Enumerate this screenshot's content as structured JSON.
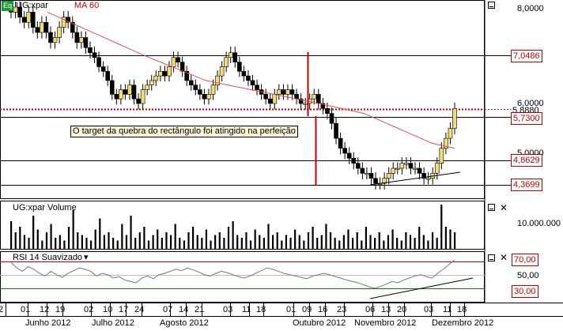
{
  "main": {
    "symbol_badge": "Eq",
    "symbol": "UG:xpar",
    "indicator": "MA 60",
    "annotation": "O target da quebra do rectângulo foi atingido na perfeição",
    "axis_labels": [
      "8,0000",
      "6,0000",
      "5,0000"
    ],
    "price_tags": [
      {
        "text": "7,0486",
        "color": "#c00000",
        "value": 7.0486
      },
      {
        "text": "5,8880",
        "color": "#000000",
        "value": 5.888
      },
      {
        "text": "5,7300",
        "color": "#c00000",
        "value": 5.73
      },
      {
        "text": "4,8629",
        "color": "#c00000",
        "value": 4.8629
      },
      {
        "text": "4,3699",
        "color": "#c00000",
        "value": 4.3699
      }
    ]
  },
  "volume": {
    "title": "UG:xpar Volume",
    "axis_label": "10.000.000"
  },
  "rsi": {
    "title": "RSI 14 Suavizado",
    "levels": [
      {
        "text": "70,00",
        "value": 70,
        "color": "#c00000"
      },
      {
        "text": "50,00",
        "value": 50,
        "color": "#000000"
      },
      {
        "text": "30,00",
        "value": 30,
        "color": "#c00000"
      }
    ]
  },
  "x_axis": {
    "days": [
      "2",
      "01",
      "12",
      "19",
      "02",
      "10",
      "17",
      "24",
      "07",
      "14",
      "21",
      "03",
      "11",
      "18",
      "01",
      "09",
      "16",
      "23",
      "06",
      "13",
      "20",
      "03",
      "11",
      "18"
    ],
    "months": [
      "Junho 2012",
      "Julho 2012",
      "Agosto 2012",
      "Outubro 2012",
      "Novembro 2012",
      "Dezembro 2012"
    ]
  },
  "colors": {
    "bull": "#f0dc70",
    "bear": "#000000",
    "ma": "#e05050",
    "level_line": "#c00000",
    "rsi_70": "#c00000",
    "rsi_30": "#008000"
  },
  "chart_data": {
    "type": "candlestick",
    "price_axis": {
      "ticks": [
        5.0,
        6.0,
        8.0
      ]
    },
    "close_series": [
      7.9,
      8.0,
      7.8,
      7.7,
      7.9,
      7.6,
      7.5,
      7.7,
      7.5,
      7.3,
      7.4,
      7.6,
      7.8,
      7.7,
      7.5,
      7.3,
      7.4,
      7.2,
      7.1,
      7.0,
      6.8,
      6.7,
      6.5,
      6.2,
      6.1,
      6.3,
      6.2,
      6.4,
      6.1,
      6.0,
      6.3,
      6.4,
      6.5,
      6.6,
      6.7,
      6.6,
      6.8,
      7.0,
      6.9,
      6.7,
      6.5,
      6.4,
      6.3,
      6.2,
      6.1,
      6.2,
      6.4,
      6.6,
      6.8,
      7.0,
      7.1,
      6.9,
      6.7,
      6.6,
      6.5,
      6.4,
      6.3,
      6.2,
      6.1,
      6.0,
      6.2,
      6.3,
      6.2,
      6.3,
      6.2,
      6.1,
      6.0,
      6.0,
      6.1,
      6.2,
      6.0,
      5.9,
      5.8,
      5.6,
      5.3,
      5.1,
      5.0,
      4.9,
      4.8,
      4.7,
      4.6,
      4.6,
      4.5,
      4.4,
      4.4,
      4.5,
      4.6,
      4.7,
      4.7,
      4.8,
      4.8,
      4.7,
      4.7,
      4.6,
      4.5,
      4.5,
      4.6,
      4.8,
      5.1,
      5.3,
      5.5,
      5.9
    ],
    "ma60": [
      7.9,
      7.8,
      7.7,
      7.6,
      7.5,
      7.4,
      7.3,
      7.2,
      7.1,
      7.0,
      6.9,
      6.8,
      6.7,
      6.6,
      6.5,
      6.45,
      6.4,
      6.35,
      6.3,
      6.25,
      6.2,
      6.15,
      6.1,
      6.05,
      6.0,
      5.95,
      5.9,
      5.85,
      5.8,
      5.7,
      5.6,
      5.5,
      5.4,
      5.3,
      5.2,
      5.15,
      5.1
    ],
    "volume": [
      10,
      6,
      8,
      5,
      4,
      12,
      7,
      3,
      6,
      9,
      4,
      5,
      3,
      8,
      14,
      6,
      5,
      4,
      3,
      7,
      11,
      5,
      6,
      4,
      3,
      9,
      5,
      12,
      4,
      6,
      8,
      3,
      5,
      7,
      4,
      6,
      5,
      9,
      4,
      3,
      6,
      8,
      5,
      4,
      7,
      3,
      5,
      6,
      4,
      8,
      10,
      5,
      4,
      6,
      3,
      7,
      5,
      4,
      9,
      5,
      6,
      3,
      5,
      4,
      7,
      5,
      3,
      6,
      8,
      4,
      5,
      9,
      6,
      4,
      3,
      5,
      7,
      4,
      6,
      3,
      8,
      5,
      4,
      6,
      3,
      5,
      7,
      4,
      3,
      6,
      5,
      4,
      8,
      5,
      3,
      6,
      4,
      16,
      8,
      7,
      6
    ],
    "volume_axis": {
      "label_value": 10000000
    },
    "rsi": [
      68,
      60,
      55,
      62,
      58,
      52,
      48,
      55,
      50,
      46,
      52,
      56,
      60,
      58,
      55,
      48,
      52,
      50,
      45,
      47,
      42,
      40,
      38,
      45,
      48,
      44,
      50,
      52,
      55,
      58,
      56,
      60,
      57,
      54,
      50,
      48,
      52,
      55,
      53,
      50,
      47,
      45,
      48,
      52,
      56,
      60,
      58,
      55,
      52,
      50,
      48,
      46,
      44,
      48,
      50,
      52,
      50,
      47,
      45,
      42,
      40,
      38,
      35,
      32,
      30,
      33,
      36,
      40,
      38,
      42,
      45,
      48,
      50,
      47,
      45,
      52,
      58,
      65,
      72
    ]
  }
}
